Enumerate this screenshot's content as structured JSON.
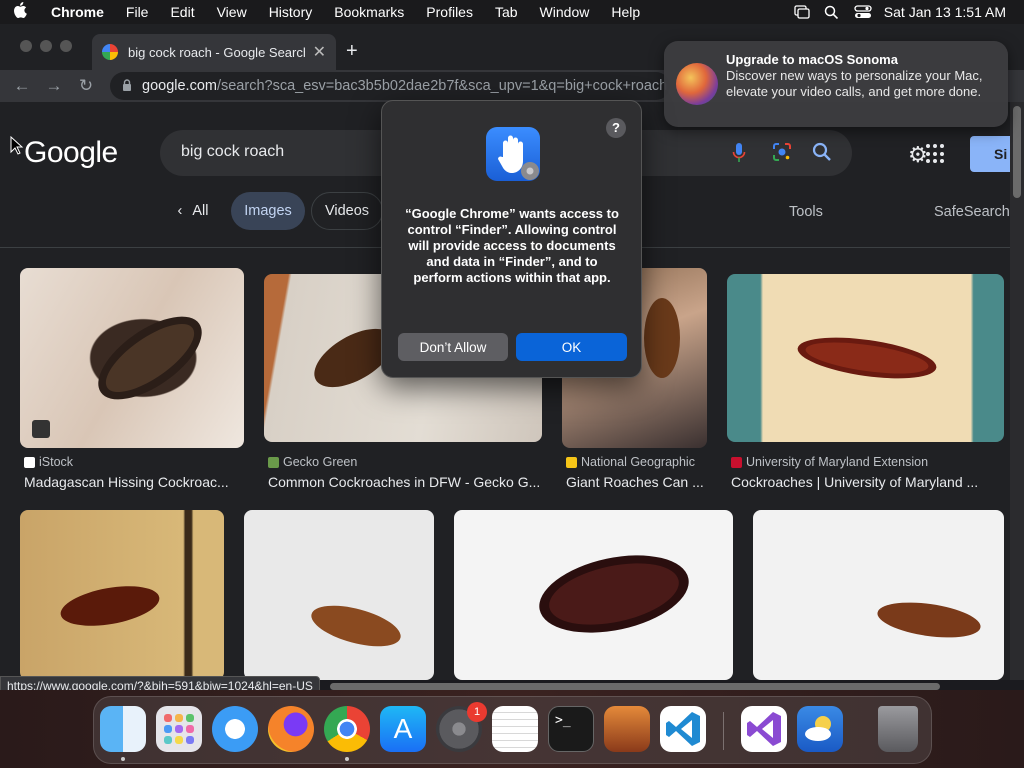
{
  "menubar": {
    "app": "Chrome",
    "items": [
      "File",
      "Edit",
      "View",
      "History",
      "Bookmarks",
      "Profiles",
      "Tab",
      "Window",
      "Help"
    ],
    "datetime": "Sat Jan 13  1:51 AM"
  },
  "browser": {
    "tab_title": "big cock roach - Google Search",
    "url_host": "google.com",
    "url_path": "/search?sca_esv=bac3b5b02dae2b7f&sca_upv=1&q=big+cock+roach"
  },
  "google": {
    "logo": "Google",
    "query": "big cock roach",
    "signin_label": "Si",
    "chips": [
      "All",
      "Images",
      "Videos"
    ],
    "tools_label": "Tools",
    "safesearch_label": "SafeSearch"
  },
  "results": [
    {
      "source": "iStock",
      "title": "Madagascan Hissing Cockroac..."
    },
    {
      "source": "Gecko Green",
      "title": "Common Cockroaches in DFW - Gecko G..."
    },
    {
      "source": "National Geographic",
      "title": "Giant Roaches Can ..."
    },
    {
      "source": "University of Maryland Extension",
      "title": "Cockroaches | University of Maryland ..."
    }
  ],
  "status_url": "https://www.google.com/?&bih=591&biw=1024&hl=en-US",
  "notification": {
    "title": "Upgrade to macOS Sonoma",
    "body": "Discover new ways to personalize your Mac, elevate your video calls, and get more done."
  },
  "dialog": {
    "help": "?",
    "message": "“Google Chrome” wants access to control “Finder”. Allowing control will provide access to documents and data in “Finder”, and to perform actions within that app.",
    "deny_label": "Don’t Allow",
    "ok_label": "OK"
  },
  "dock": {
    "settings_badge": "1",
    "apps": [
      "finder-icon",
      "launchpad-icon",
      "safari-icon",
      "firefox-icon",
      "chrome-icon",
      "app-store-icon",
      "system-settings-icon",
      "textedit-icon",
      "terminal-icon",
      "garageband-icon",
      "vscode-icon",
      "visual-studio-icon",
      "weather-icon",
      "trash-icon"
    ]
  },
  "colors": {
    "accent_blue": "#0a64d8",
    "google_dark_bg": "#202124",
    "active_chip": "#394457"
  }
}
